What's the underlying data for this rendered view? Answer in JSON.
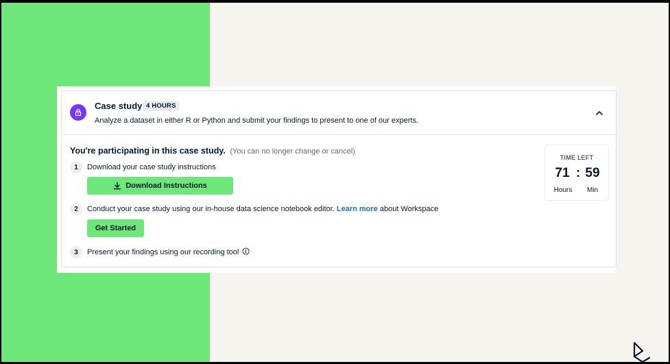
{
  "case_study": {
    "title": "Case study",
    "duration": "4 HOURS",
    "description": "Analyze a dataset in either R or Python and submit your findings to present to one of our experts."
  },
  "status": {
    "heading": "You're participating in this case study.",
    "note": "(You can no longer change or cancel)"
  },
  "steps": [
    {
      "number": "1",
      "text": "Download your case study instructions",
      "button": "Download Instructions"
    },
    {
      "number": "2",
      "text_before": "Conduct your case study using our in-house data science notebook editor.",
      "link": "Learn more",
      "text_after": "about Workspace",
      "button": "Get Started"
    },
    {
      "number": "3",
      "text": "Present your findings using our recording tool"
    }
  ],
  "timer": {
    "label": "TIME LEFT",
    "hours": "71",
    "separator": ":",
    "minutes": "59",
    "hours_unit": "Hours",
    "minutes_unit": "Min"
  },
  "colors": {
    "brand_green": "#6fe679",
    "brand_purple": "#7933ff",
    "navy": "#05192d",
    "link_blue": "#1f6fa8",
    "background_cream": "#f7f3ee"
  },
  "icons": [
    "lock-icon",
    "chevron-up-icon",
    "download-icon",
    "info-icon",
    "datacamp-logo"
  ]
}
